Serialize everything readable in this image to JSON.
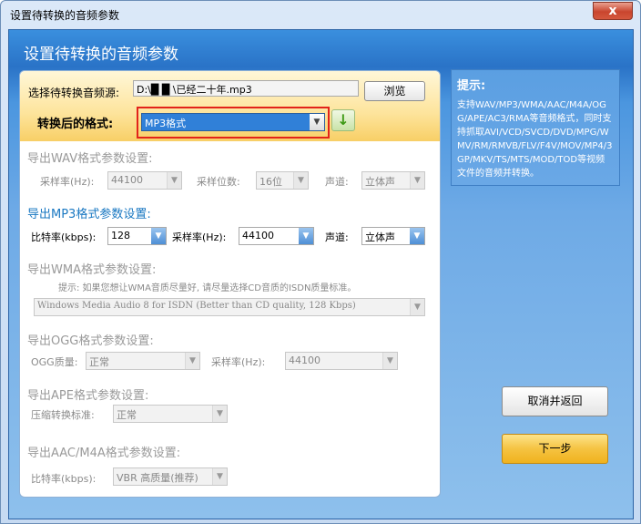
{
  "window": {
    "title": "设置待转换的音频参数",
    "close": "x"
  },
  "header": {
    "title": "设置待转换的音频参数"
  },
  "source": {
    "label": "选择待转换音频源:",
    "path": "D:\\█ █ \\已经二十年.mp3",
    "browse": "浏览"
  },
  "format": {
    "label": "转换后的格式:",
    "value": "MP3格式"
  },
  "wav": {
    "title": "导出WAV格式参数设置:",
    "rate_label": "采样率(Hz):",
    "rate": "44100",
    "bits_label": "采样位数:",
    "bits": "16位",
    "channel_label": "声道:",
    "channel": "立体声"
  },
  "mp3": {
    "title": "导出MP3格式参数设置:",
    "bitrate_label": "比特率(kbps):",
    "bitrate": "128",
    "rate_label": "采样率(Hz):",
    "rate": "44100",
    "channel_label": "声道:",
    "channel": "立体声"
  },
  "wma": {
    "title": "导出WMA格式参数设置:",
    "hint": "提示: 如果您想让WMA音质尽量好, 请尽量选择CD音质的ISDN质量标准。",
    "profile": "Windows Media Audio 8 for ISDN (Better than CD quality, 128 Kbps)"
  },
  "ogg": {
    "title": "导出OGG格式参数设置:",
    "quality_label": "OGG质量:",
    "quality": "正常",
    "rate_label": "采样率(Hz):",
    "rate": "44100"
  },
  "ape": {
    "title": "导出APE格式参数设置:",
    "std_label": "压缩转换标准:",
    "std": "正常"
  },
  "aac": {
    "title": "导出AAC/M4A格式参数设置:",
    "bitrate_label": "比特率(kbps):",
    "bitrate": "VBR 高质量(推荐)"
  },
  "hint": {
    "title": "提示:",
    "body": "支持WAV/MP3/WMA/AAC/M4A/OGG/APE/AC3/RMA等音频格式，同时支持抓取AVI/VCD/SVCD/DVD/MPG/WMV/RM/RMVB/FLV/F4V/MOV/MP4/3GP/MKV/TS/MTS/MOD/TOD等视频文件的音频并转换。"
  },
  "buttons": {
    "cancel": "取消并返回",
    "next": "下一步"
  },
  "colors": {
    "accent": "#1a78c2",
    "highlight_border": "#e2231a",
    "next_button": "#f5c342"
  }
}
